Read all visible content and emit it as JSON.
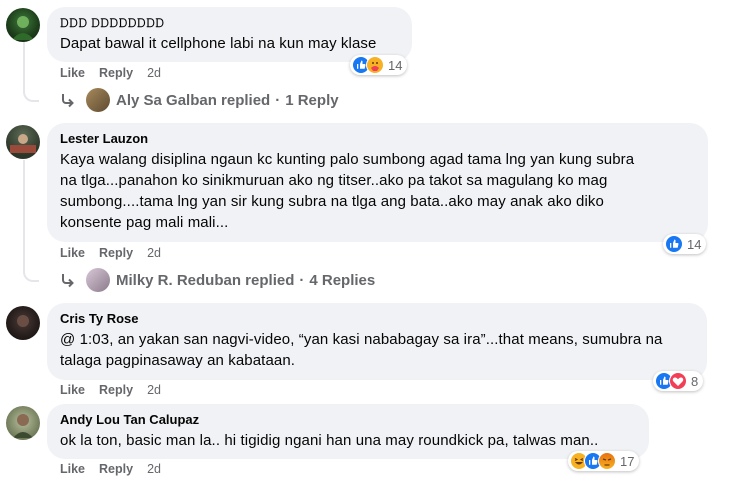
{
  "comments": [
    {
      "name": "𝙳𝙳𝙳 𝙳𝙳𝙳𝙳𝙳𝙳𝙳𝙳",
      "text": [
        "Dapat bawal it cellphone labi na kun may klase"
      ],
      "like": "Like",
      "reply": "Reply",
      "time": "2d",
      "reaction_icons": [
        "like-icon",
        "care-icon"
      ],
      "reaction_count": "14",
      "replies": {
        "name": "Aly Sa Galban replied",
        "sep": "·",
        "count": "1 Reply"
      }
    },
    {
      "name": "Lester Lauzon",
      "text": [
        "Kaya walang disiplina ngaun kc kunting palo sumbong agad tama lng yan kung subra",
        "na tlga...panahon ko sinikmuruan ako ng titser..ako pa takot sa magulang ko mag",
        "sumbong....tama lng yan sir kung subra na tlga ang bata..ako may anak ako diko",
        "konsente pag mali mali..."
      ],
      "like": "Like",
      "reply": "Reply",
      "time": "2d",
      "reaction_icons": [
        "like-icon"
      ],
      "reaction_count": "14",
      "replies": {
        "name": "Milky R. Reduban replied",
        "sep": "·",
        "count": "4 Replies"
      }
    },
    {
      "name": "Cris Ty Rose",
      "text": [
        "@ 1:03, an yakan san nagvi-video, “yan kasi nababagay sa ira”...that means, sumubra na",
        "talaga pagpinasaway an kabataan."
      ],
      "like": "Like",
      "reply": "Reply",
      "time": "2d",
      "reaction_icons": [
        "like-icon",
        "love-icon"
      ],
      "reaction_count": "8"
    },
    {
      "name": "Andy Lou Tan Calupaz",
      "text": [
        "ok la ton, basic man la.. hi tigidig ngani han una may roundkick pa, talwas man.."
      ],
      "like": "Like",
      "reply": "Reply",
      "time": "2d",
      "reaction_icons": [
        "haha-icon",
        "like-icon",
        "angry-icon"
      ],
      "reaction_count": "17"
    }
  ],
  "colors": {
    "bubble": "#f0f2f5",
    "meta": "#65676b",
    "like_blue": "#1877f2",
    "love_red": "#f33e58",
    "haha_yellow": "#f7b125"
  }
}
